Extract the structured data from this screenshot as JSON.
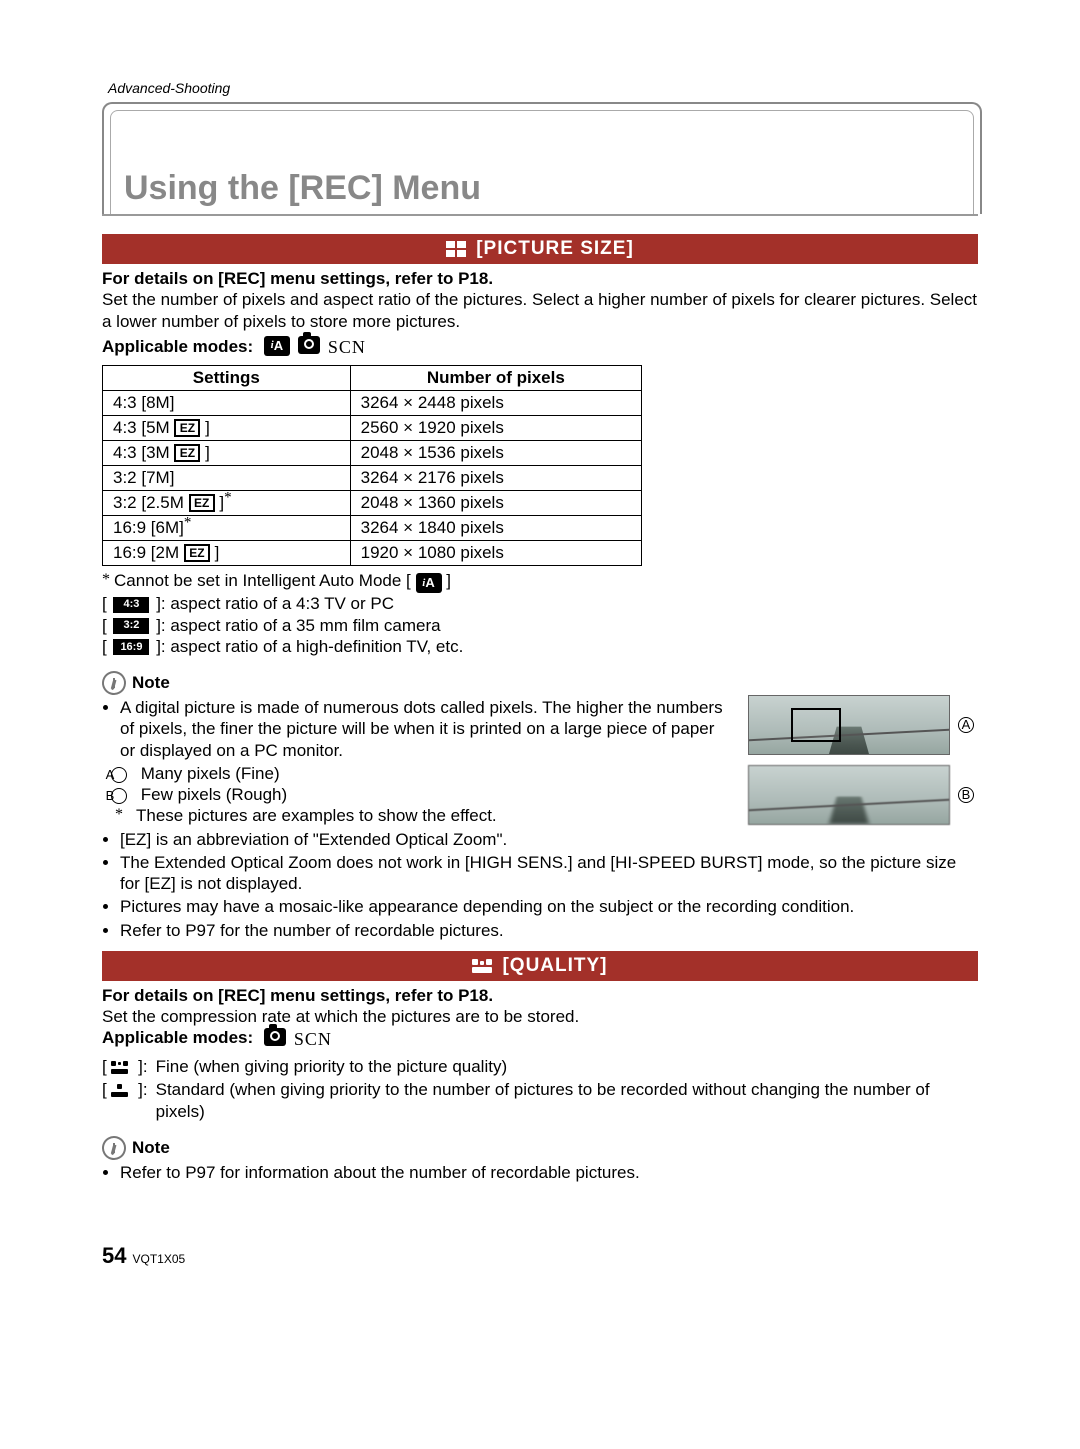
{
  "section_path": "Advanced-Shooting",
  "page_title": "Using the [REC] Menu",
  "picture_size": {
    "heading_icon": "picture-size-icon",
    "heading": "[PICTURE SIZE]",
    "ref_line": "For details on [REC] menu settings, refer to P18.",
    "description": "Set the number of pixels and aspect ratio of the pictures. Select a higher number of pixels for clearer pictures. Select a lower number of pixels to store more pictures.",
    "applicable_label": "Applicable modes:",
    "applicable_modes": {
      "ia": "iA",
      "camera": true,
      "scn": "SCN"
    },
    "table": {
      "headers": {
        "settings": "Settings",
        "pixels": "Number of pixels"
      },
      "rows": [
        {
          "label": "4:3 [8M]",
          "ez": false,
          "ast": false,
          "pixels": "3264 × 2448 pixels"
        },
        {
          "label": "4:3 [5M",
          "ez": true,
          "ast": false,
          "close": "]",
          "pixels": "2560 × 1920 pixels"
        },
        {
          "label": "4:3 [3M",
          "ez": true,
          "ast": false,
          "close": "]",
          "pixels": "2048 × 1536 pixels"
        },
        {
          "label": "3:2 [7M]",
          "ez": false,
          "ast": false,
          "pixels": "3264 × 2176 pixels"
        },
        {
          "label": "3:2 [2.5M",
          "ez": true,
          "ast": true,
          "close": "]",
          "pixels": "2048 × 1360 pixels"
        },
        {
          "label": "16:9 [6M]",
          "ez": false,
          "ast": true,
          "pixels": "3264 × 1840 pixels"
        },
        {
          "label": "16:9 [2M",
          "ez": true,
          "ast": false,
          "close": "]",
          "pixels": "1920 × 1080 pixels"
        }
      ]
    },
    "footnotes": {
      "ast": "Cannot be set in Intelligent Auto Mode [",
      "ast_close": "]",
      "r43": {
        "badge": "4:3",
        "text": "]: aspect ratio of a 4:3 TV or PC"
      },
      "r32": {
        "badge": "3:2",
        "text": "]: aspect ratio of a 35 mm film camera"
      },
      "r169": {
        "badge": "16:9",
        "text": "]: aspect ratio of a high-definition TV, etc."
      }
    },
    "note_label": "Note",
    "note_bullets": {
      "b1": "A digital picture is made of numerous dots called pixels. The higher the numbers of pixels, the finer the picture will be when it is printed on a large piece of paper or displayed on a PC monitor.",
      "b1a": "Many pixels (Fine)",
      "b1b": "Few pixels (Rough)",
      "b1a_mark": "A",
      "b1b_mark": "B",
      "b1c": "These pictures are examples to show the effect.",
      "b2": "[EZ] is an abbreviation of \"Extended Optical Zoom\".",
      "b3": "The Extended Optical Zoom does not work in [HIGH SENS.] and [HI-SPEED BURST] mode, so the picture size for [EZ] is not displayed.",
      "b4": "Pictures may have a mosaic-like appearance depending on the subject or the recording condition.",
      "b5": "Refer to P97 for the number of recordable pictures."
    },
    "thumb_label_a": "A",
    "thumb_label_b": "B"
  },
  "quality": {
    "heading_icon": "quality-icon",
    "heading": "[QUALITY]",
    "ref_line": "For details on [REC] menu settings, refer to P18.",
    "description": "Set the compression rate at which the pictures are to be stored.",
    "applicable_label": "Applicable modes:",
    "applicable_modes": {
      "camera": true,
      "scn": "SCN"
    },
    "items": {
      "fine": "Fine (when giving priority to the picture quality)",
      "standard": "Standard (when giving priority to the number of pictures to be recorded without changing the number of pixels)"
    },
    "note_label": "Note",
    "note_bullet": "Refer to P97 for information about the number of recordable pictures."
  },
  "footer": {
    "page_number": "54",
    "doc_code": "VQT1X05"
  }
}
